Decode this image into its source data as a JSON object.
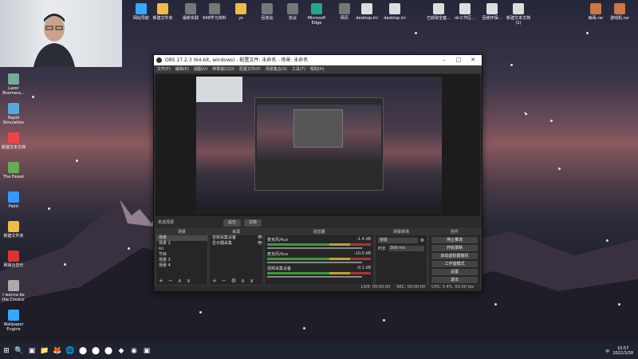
{
  "desktop": {
    "left_icons": [
      {
        "label": "Lazer Boomera...",
        "color": "#7a9"
      },
      {
        "label": "Rapid Simulation",
        "color": "#5ad"
      },
      {
        "label": "新建文本文档",
        "color": "#e44"
      },
      {
        "label": "The Forest",
        "color": "#6a5"
      },
      {
        "label": "Paint",
        "color": "#39f"
      },
      {
        "label": "新建文件夹",
        "color": "#eb4"
      },
      {
        "label": "网易云音乐",
        "color": "#d33"
      },
      {
        "label": "I wanna be the Creator",
        "color": "#aaa"
      },
      {
        "label": "Wallpaper Engine",
        "color": "#3af"
      }
    ],
    "top_icons": [
      {
        "label": "网站导航",
        "color": "#3af"
      },
      {
        "label": "新建文件夹",
        "color": "#eb4"
      },
      {
        "label": "最新实践",
        "color": "#777"
      },
      {
        "label": "648学习资料",
        "color": "#777"
      },
      {
        "label": "ys",
        "color": "#eb4"
      },
      {
        "label": "回收站",
        "color": "#777"
      },
      {
        "label": "协议",
        "color": "#777"
      },
      {
        "label": "Microsoft Edge",
        "color": "#2a8"
      },
      {
        "label": "网页",
        "color": "#777"
      },
      {
        "label": "desktop.ini",
        "color": "#ddd"
      },
      {
        "label": "desktop.ini",
        "color": "#ddd"
      },
      {
        "label": "已获取全套...",
        "color": "#ddd"
      },
      {
        "label": "ok工作区...",
        "color": "#ddd"
      },
      {
        "label": "回收环保...",
        "color": "#ddd"
      },
      {
        "label": "新建文本文档 (1)",
        "color": "#ddd"
      },
      {
        "label": "病毒.rar",
        "color": "#c74"
      },
      {
        "label": "游戏机.rar",
        "color": "#c74"
      }
    ]
  },
  "obs": {
    "title": "OBS 27.2.3 (64-bit, windows) - 配置文件: 未命名 - 场景: 未命名",
    "menu": [
      "文件(F)",
      "编辑(E)",
      "视图(V)",
      "停靠窗口(D)",
      "配置文件(P)",
      "场景集合(S)",
      "工具(T)",
      "帮助(H)"
    ],
    "source_label": "未选择源",
    "tabs": [
      "属性",
      "滤镜"
    ],
    "docks": {
      "scenes": {
        "title": "场景",
        "items": [
          "场景",
          "场景 2",
          "lol",
          "节目",
          "场景 3",
          "场景 4"
        ]
      },
      "sources": {
        "title": "来源",
        "items": [
          "音频采集设备",
          "显示器采集"
        ]
      },
      "mixer": {
        "title": "混音器",
        "channels": [
          {
            "name": "麦克风/Aux",
            "value": "-1.4 dB"
          },
          {
            "name": "麦克风/Aux",
            "value": "-10.0 dB"
          },
          {
            "name": "视频采集设备",
            "value": "-0.1 dB"
          }
        ]
      },
      "transitions": {
        "title": "场景转场",
        "type": "渐变",
        "duration_label": "时长",
        "duration": "300 ms"
      },
      "controls": {
        "title": "控件",
        "buttons": [
          "停止推流",
          "开始录制",
          "启动虚拟摄像机",
          "工作室模式",
          "设置",
          "退出"
        ]
      }
    },
    "status": [
      "LIVE: 00:00:00",
      "REC: 00:00:00",
      "CPU: 3.4%, 60.00 fps"
    ]
  },
  "taskbar": {
    "icons": [
      "⊞",
      "🔍",
      "▣",
      "📁",
      "🦊",
      "🌐",
      "⬤",
      "⬤",
      "⬤",
      "◆",
      "◉",
      "▣"
    ],
    "time": "10:57",
    "date": "2022/3/28",
    "lang": "中"
  }
}
